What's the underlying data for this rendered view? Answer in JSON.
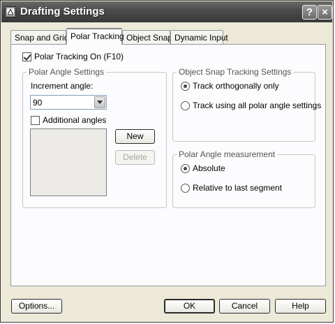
{
  "window": {
    "title": "Drafting Settings",
    "help_button": "?",
    "close_button": "×"
  },
  "tabs": [
    {
      "label": "Snap and Grid",
      "active": false
    },
    {
      "label": "Polar Tracking",
      "active": true
    },
    {
      "label": "Object Snap",
      "active": false
    },
    {
      "label": "Dynamic Input",
      "active": false
    }
  ],
  "polar": {
    "tracking_on_label": "Polar Tracking On (F10)",
    "tracking_on_checked": true,
    "angle_settings": {
      "group_title": "Polar Angle Settings",
      "increment_label": "Increment angle:",
      "increment_value": "90",
      "additional_label": "Additional angles",
      "additional_checked": false,
      "new_button": "New",
      "delete_button": "Delete"
    },
    "object_snap": {
      "group_title": "Object Snap Tracking Settings",
      "option1": "Track orthogonally only",
      "option2": "Track using all polar angle settings",
      "selected": "option1"
    },
    "measurement": {
      "group_title": "Polar Angle measurement",
      "option1": "Absolute",
      "option2": "Relative to last segment",
      "selected": "option1"
    }
  },
  "footer": {
    "options_button": "Options...",
    "ok_button": "OK",
    "cancel_button": "Cancel",
    "help_button": "Help"
  }
}
